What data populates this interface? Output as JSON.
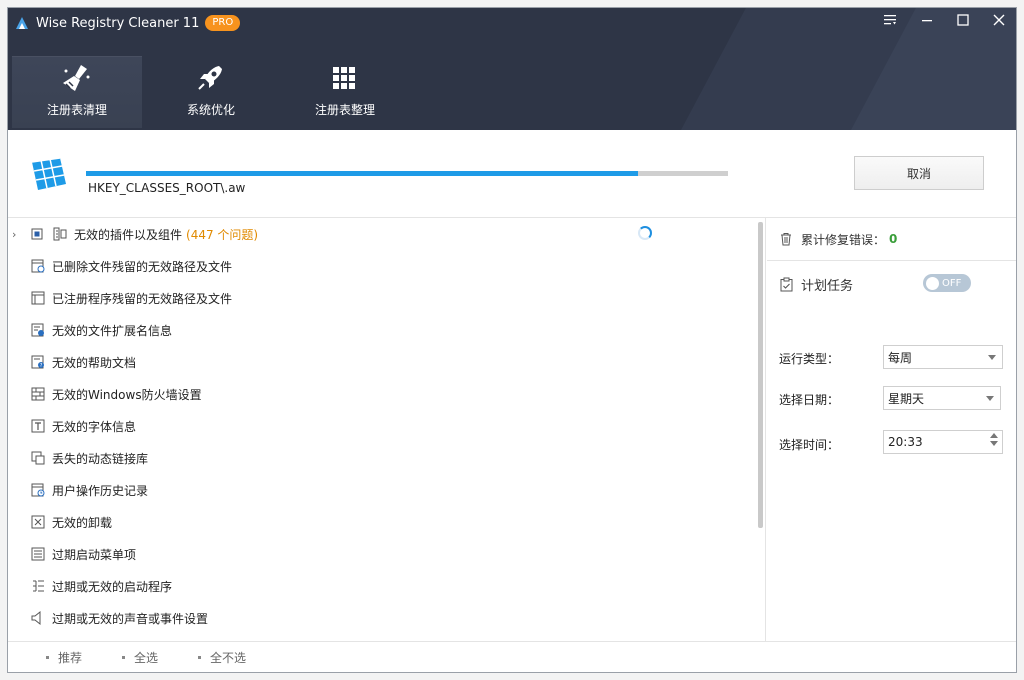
{
  "app": {
    "title": "Wise Registry Cleaner 11",
    "badge": "PRO"
  },
  "tabs": [
    {
      "label": "注册表清理",
      "icon": "broom-icon",
      "active": true
    },
    {
      "label": "系统优化",
      "icon": "rocket-icon",
      "active": false
    },
    {
      "label": "注册表整理",
      "icon": "grid-icon",
      "active": false
    }
  ],
  "scan": {
    "path": "HKEY_CLASSES_ROOT\\.aw",
    "progress": 0.86,
    "cancel_label": "取消"
  },
  "items": [
    {
      "label": "无效的插件以及组件",
      "count": "(447 个问题)"
    },
    {
      "label": "已删除文件残留的无效路径及文件"
    },
    {
      "label": "已注册程序残留的无效路径及文件"
    },
    {
      "label": "无效的文件扩展名信息"
    },
    {
      "label": "无效的帮助文档"
    },
    {
      "label": "无效的Windows防火墙设置"
    },
    {
      "label": "无效的字体信息"
    },
    {
      "label": "丢失的动态链接库"
    },
    {
      "label": "用户操作历史记录"
    },
    {
      "label": "无效的卸载"
    },
    {
      "label": "过期启动菜单项"
    },
    {
      "label": "过期或无效的启动程序"
    },
    {
      "label": "过期或无效的声音或事件设置"
    }
  ],
  "right": {
    "fixed_label": "累计修复错误：",
    "fixed_count": "0",
    "schedule_label": "计划任务",
    "toggle_label": "OFF",
    "run_type_label": "运行类型：",
    "run_type_value": "每周",
    "date_label": "选择日期：",
    "date_value": "星期天",
    "time_label": "选择时间：",
    "time_value": "20:33"
  },
  "footer": {
    "recommend": "推荐",
    "select_all": "全选",
    "select_none": "全不选"
  },
  "colors": {
    "header_bg": "#2e3546",
    "progress": "#1e9be7",
    "badge": "#f7931e",
    "issue_count": "#e08a00"
  }
}
